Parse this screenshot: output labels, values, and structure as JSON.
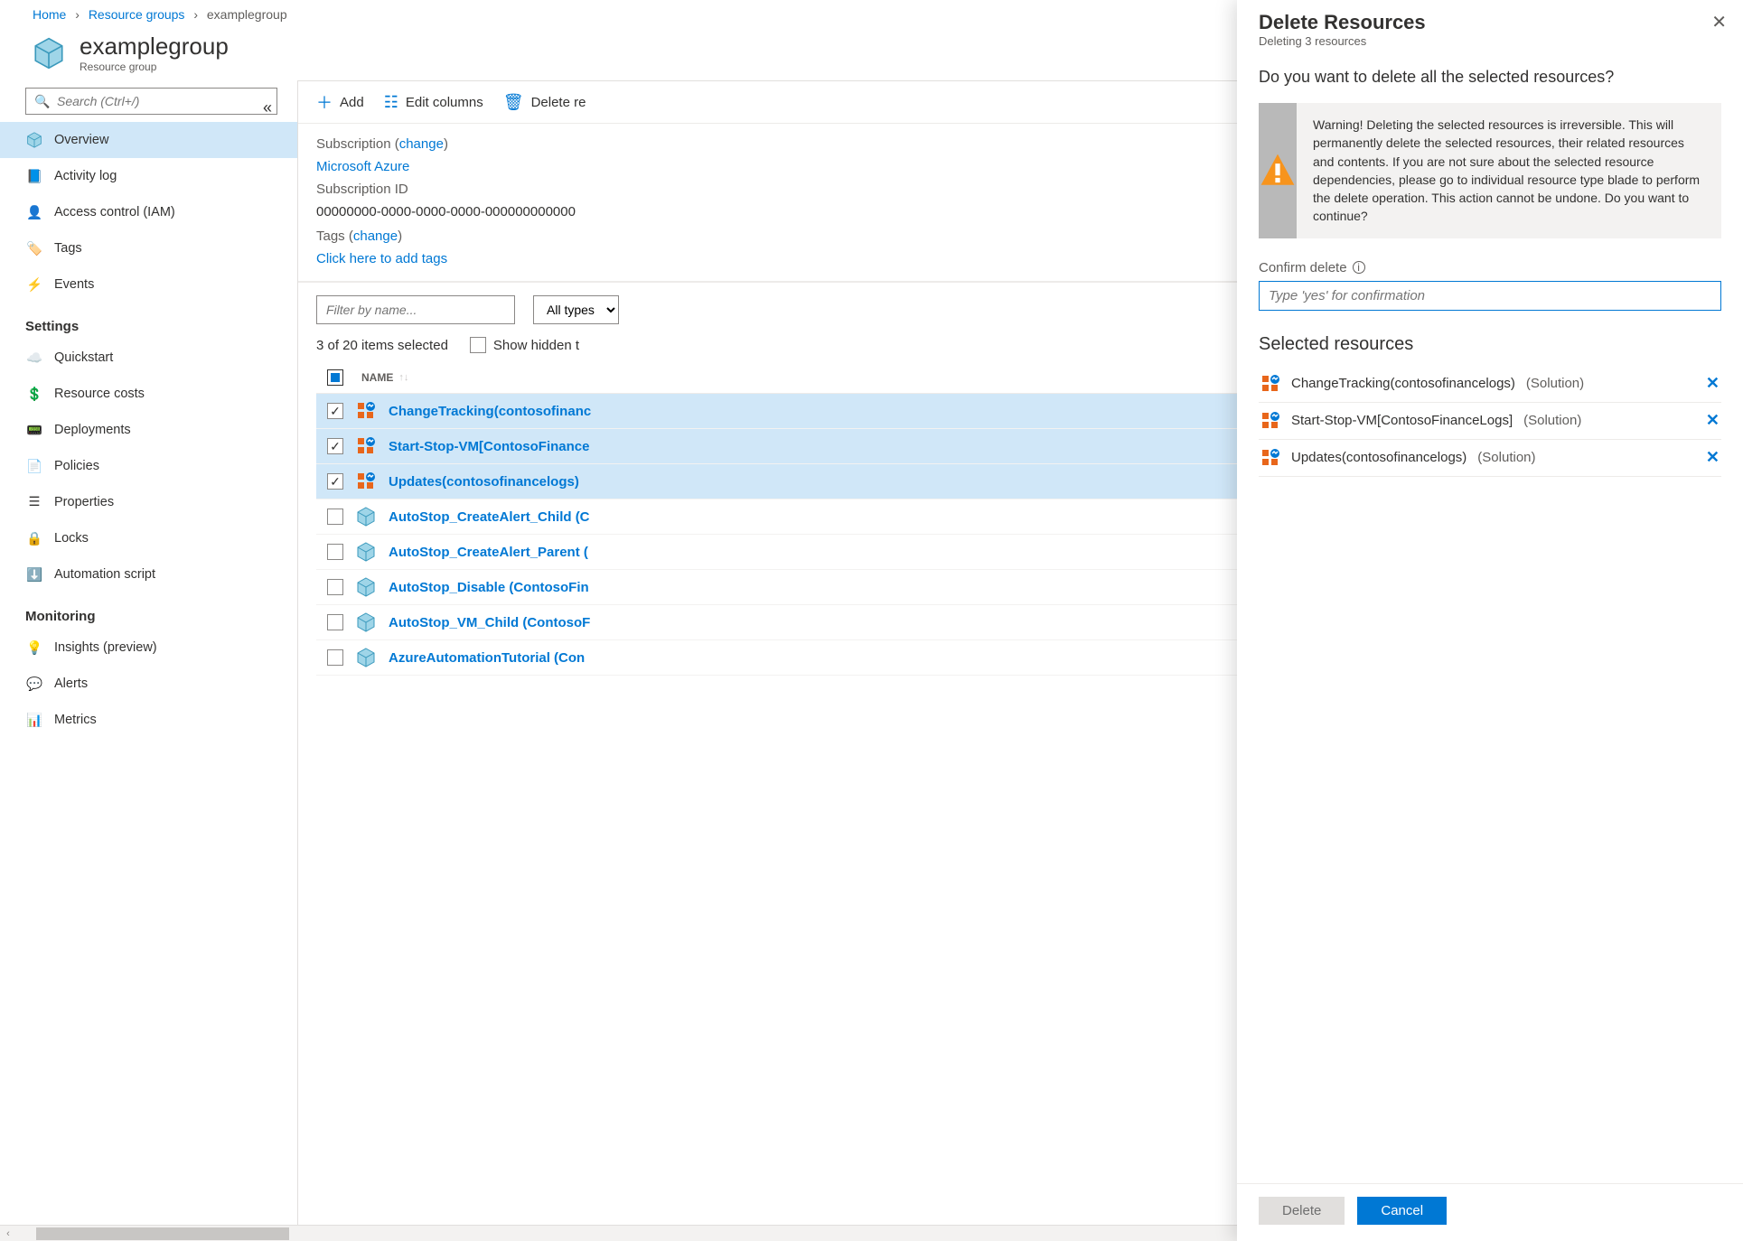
{
  "breadcrumb": {
    "home": "Home",
    "rg": "Resource groups",
    "current": "examplegroup"
  },
  "header": {
    "title": "examplegroup",
    "subtitle": "Resource group"
  },
  "sidebar": {
    "search_placeholder": "Search (Ctrl+/)",
    "items_top": [
      {
        "label": "Overview",
        "icon": "cube"
      },
      {
        "label": "Activity log",
        "icon": "log"
      },
      {
        "label": "Access control (IAM)",
        "icon": "iam"
      },
      {
        "label": "Tags",
        "icon": "tag"
      },
      {
        "label": "Events",
        "icon": "bolt"
      }
    ],
    "heading_settings": "Settings",
    "items_settings": [
      {
        "label": "Quickstart",
        "icon": "cloud"
      },
      {
        "label": "Resource costs",
        "icon": "cost"
      },
      {
        "label": "Deployments",
        "icon": "deploy"
      },
      {
        "label": "Policies",
        "icon": "policy"
      },
      {
        "label": "Properties",
        "icon": "props"
      },
      {
        "label": "Locks",
        "icon": "lock"
      },
      {
        "label": "Automation script",
        "icon": "script"
      }
    ],
    "heading_monitoring": "Monitoring",
    "items_monitoring": [
      {
        "label": "Insights (preview)",
        "icon": "bulb"
      },
      {
        "label": "Alerts",
        "icon": "alert"
      },
      {
        "label": "Metrics",
        "icon": "metrics"
      }
    ]
  },
  "toolbar": {
    "add": "Add",
    "edit_columns": "Edit columns",
    "delete_rg": "Delete re"
  },
  "meta": {
    "subscription_label": "Subscription",
    "subscription_change": "change",
    "subscription_link": "Microsoft Azure",
    "sub_id_label": "Subscription ID",
    "sub_id_value": "00000000-0000-0000-0000-000000000000",
    "tags_label": "Tags",
    "tags_change": "change",
    "tags_link": "Click here to add tags"
  },
  "list": {
    "filter_placeholder": "Filter by name...",
    "types_select": "All types",
    "count": "3 of 20 items selected",
    "show_hidden": "Show hidden t",
    "col_name": "NAME",
    "rows": [
      {
        "name": "ChangeTracking(contosofinanc",
        "icon": "solution",
        "selected": true
      },
      {
        "name": "Start-Stop-VM[ContosoFinance",
        "icon": "solution",
        "selected": true
      },
      {
        "name": "Updates(contosofinancelogs)",
        "icon": "solution",
        "selected": true
      },
      {
        "name": "AutoStop_CreateAlert_Child (C",
        "icon": "cube",
        "selected": false
      },
      {
        "name": "AutoStop_CreateAlert_Parent (",
        "icon": "cube",
        "selected": false
      },
      {
        "name": "AutoStop_Disable (ContosoFin",
        "icon": "cube",
        "selected": false
      },
      {
        "name": "AutoStop_VM_Child (ContosoF",
        "icon": "cube",
        "selected": false
      },
      {
        "name": "AzureAutomationTutorial (Con",
        "icon": "cube",
        "selected": false
      }
    ]
  },
  "panel": {
    "title": "Delete Resources",
    "subtitle": "Deleting 3 resources",
    "question": "Do you want to delete all the selected resources?",
    "warning": "Warning! Deleting the selected resources is irreversible. This will permanently delete the selected resources, their related resources and contents. If you are not sure about the selected resource dependencies, please go to individual resource type blade to perform the delete operation. This action cannot be undone. Do you want to continue?",
    "confirm_label": "Confirm delete",
    "confirm_placeholder": "Type 'yes' for confirmation",
    "selected_heading": "Selected resources",
    "selected": [
      {
        "name": "ChangeTracking(contosofinancelogs)",
        "type": "(Solution)"
      },
      {
        "name": "Start-Stop-VM[ContosoFinanceLogs]",
        "type": "(Solution)"
      },
      {
        "name": "Updates(contosofinancelogs)",
        "type": "(Solution)"
      }
    ],
    "btn_delete": "Delete",
    "btn_cancel": "Cancel"
  }
}
